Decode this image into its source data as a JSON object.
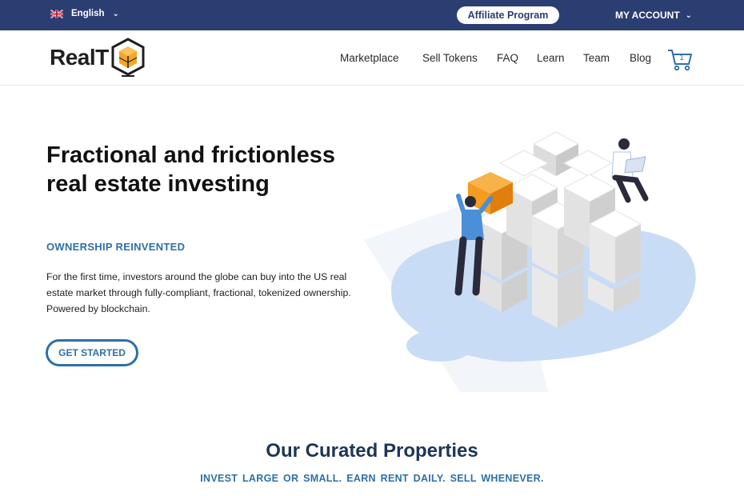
{
  "topbar": {
    "language": "English",
    "affiliate_label": "Affiliate Program",
    "account_label": "MY ACCOUNT"
  },
  "header": {
    "logo_text": "RealT",
    "nav": [
      "Marketplace",
      "Sell Tokens",
      "FAQ",
      "Learn",
      "Team",
      "Blog"
    ],
    "cart_count": "1"
  },
  "hero": {
    "title": "Fractional and frictionless real estate investing",
    "subtitle": "OWNERSHIP REINVENTED",
    "text": "For the first time, investors around the globe can buy into the US real estate market through fully-compliant, fractional, tokenized ownership. Powered by blockchain.",
    "cta_label": "GET STARTED"
  },
  "curated": {
    "title": "Our Curated Properties",
    "subtitle": "INVEST LARGE OR SMALL.  EARN RENT DAILY.  SELL WHENEVER."
  },
  "colors": {
    "topbar": "#2b3e72",
    "accent": "#2e6fa8",
    "heading_dark": "#1d3557",
    "logo_orange": "#f5a623"
  },
  "icons": [
    "uk-flag-icon",
    "chevron-down-icon",
    "realt-cube-logo-icon",
    "cart-icon"
  ]
}
